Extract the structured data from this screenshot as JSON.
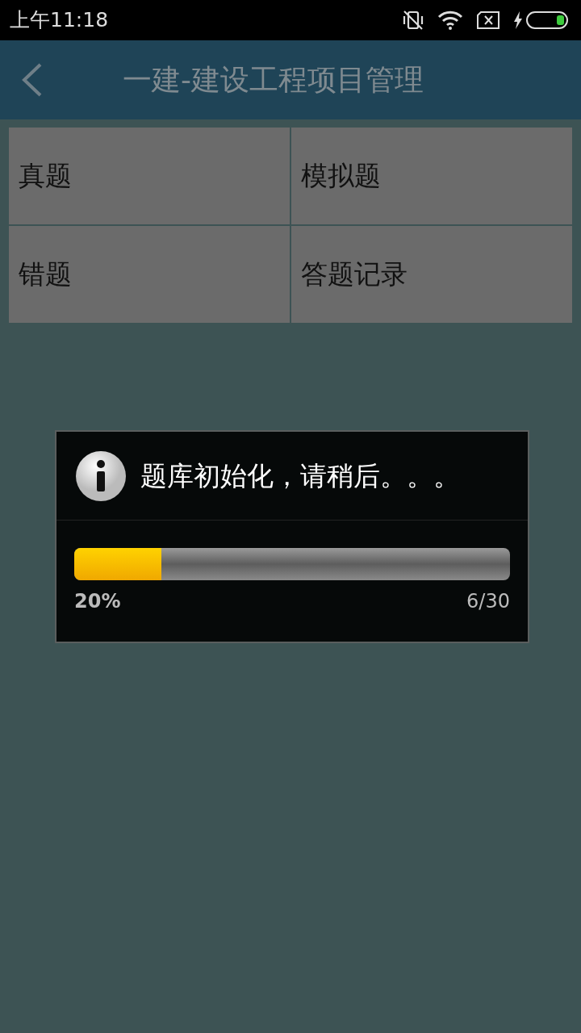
{
  "status_bar": {
    "time": "上午11:18"
  },
  "header": {
    "title": "一建-建设工程项目管理"
  },
  "menu": [
    {
      "label": "真题"
    },
    {
      "label": "模拟题"
    },
    {
      "label": "错题"
    },
    {
      "label": "答题记录"
    }
  ],
  "dialog": {
    "message": "题库初始化，请稍后。。。",
    "progress": {
      "level": 0.2
    },
    "percent": "20%",
    "count": "6/30"
  }
}
